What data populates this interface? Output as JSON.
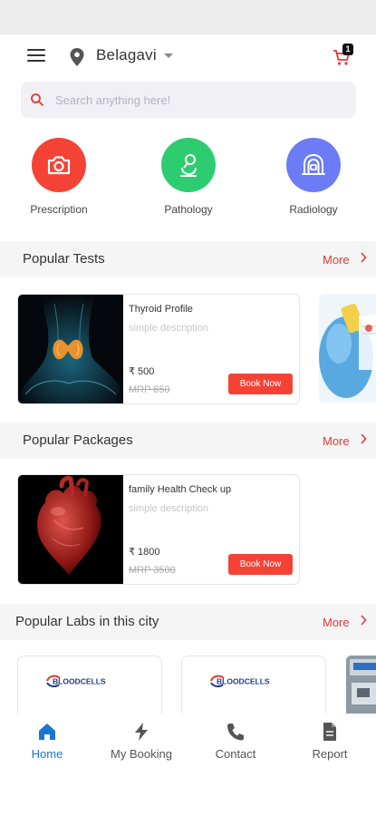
{
  "header": {
    "city": "Belagavi",
    "cart_count": "1"
  },
  "search": {
    "placeholder": "Search anything here!"
  },
  "categories": [
    {
      "label": "Prescription",
      "icon": "camera-icon",
      "color": "#f44336"
    },
    {
      "label": "Pathology",
      "icon": "microscope-icon",
      "color": "#2ecc71"
    },
    {
      "label": "Radiology",
      "icon": "xray-icon",
      "color": "#6c7cf4"
    }
  ],
  "sections": {
    "tests": {
      "title": "Popular Tests",
      "more": "More"
    },
    "packages": {
      "title": "Popular Packages",
      "more": "More"
    },
    "labs": {
      "title": "Popular Labs in this city",
      "more": "More"
    }
  },
  "tests": [
    {
      "name": "Thyroid Profile",
      "description": "simple description",
      "price": "₹ 500",
      "mrp": "MRP 650",
      "button": "Book Now"
    }
  ],
  "packages": [
    {
      "name": "family Health Check up",
      "description": "simple description",
      "price": "₹ 1800",
      "mrp": "MRP 3500",
      "button": "Book Now"
    }
  ],
  "labs": [
    {
      "logo_text": "BLOODCELLS"
    },
    {
      "logo_text": "BLOODCELLS"
    }
  ],
  "nav": [
    {
      "label": "Home",
      "icon": "home-icon",
      "active": true
    },
    {
      "label": "My Booking",
      "icon": "bolt-icon",
      "active": false
    },
    {
      "label": "Contact",
      "icon": "phone-icon",
      "active": false
    },
    {
      "label": "Report",
      "icon": "document-icon",
      "active": false
    }
  ],
  "colors": {
    "accent": "#f44336",
    "active_nav": "#1976d2"
  }
}
